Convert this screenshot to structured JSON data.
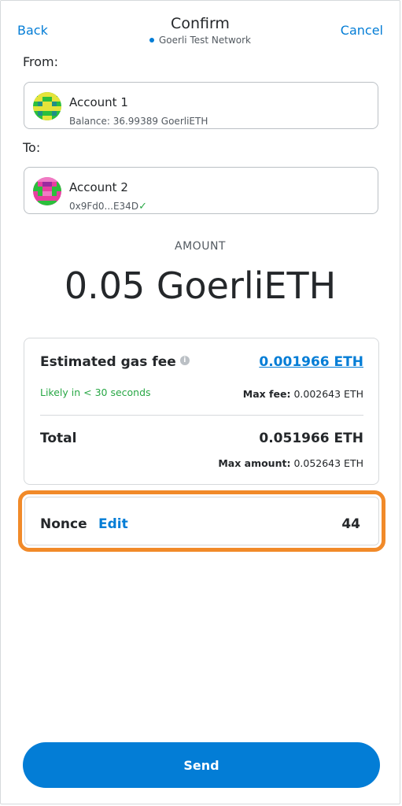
{
  "header": {
    "back_label": "Back",
    "title": "Confirm",
    "network": "Goerli Test Network",
    "cancel_label": "Cancel"
  },
  "from": {
    "label": "From:",
    "account_name": "Account 1",
    "balance": "Balance: 36.99389 GoerliETH",
    "avatar_icon": "identicon-green"
  },
  "to": {
    "label": "To:",
    "account_name": "Account 2",
    "address": "0x9Fd0...E34D",
    "verified_icon": "check-icon"
  },
  "amount": {
    "label": "AMOUNT",
    "value": "0.05 GoerliETH"
  },
  "gas": {
    "label": "Estimated gas fee",
    "info_icon": "i",
    "value": "0.001966 ETH",
    "likely": "Likely in < 30 seconds",
    "max_fee_label": "Max fee:",
    "max_fee_value": "0.002643 ETH"
  },
  "total": {
    "label": "Total",
    "value": "0.051966 ETH",
    "max_amount_label": "Max amount:",
    "max_amount_value": "0.052643 ETH"
  },
  "nonce": {
    "label": "Nonce",
    "edit_label": "Edit",
    "value": "44"
  },
  "send_label": "Send",
  "colors": {
    "accent": "#037dd6",
    "success": "#28a745",
    "highlight": "#f18a29"
  }
}
